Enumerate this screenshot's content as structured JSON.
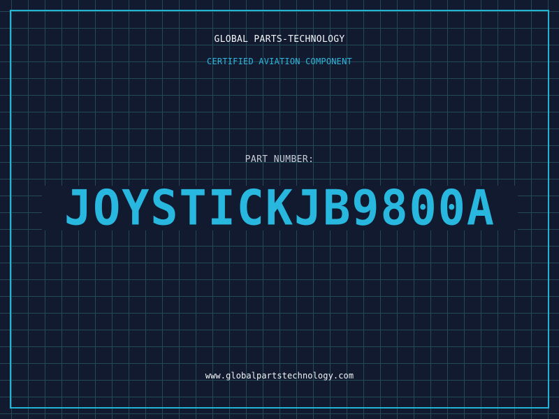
{
  "header": {
    "company": "GLOBAL PARTS-TECHNOLOGY",
    "subtitle": "CERTIFIED AVIATION COMPONENT"
  },
  "part": {
    "label": "PART NUMBER:",
    "number": "JOYSTICKJB9800A"
  },
  "footer": {
    "website": "www.globalpartstechnology.com"
  },
  "colors": {
    "background": "#111a2e",
    "grid": "#244a5a",
    "accent": "#28b8df",
    "text": "#f2f5f8"
  }
}
